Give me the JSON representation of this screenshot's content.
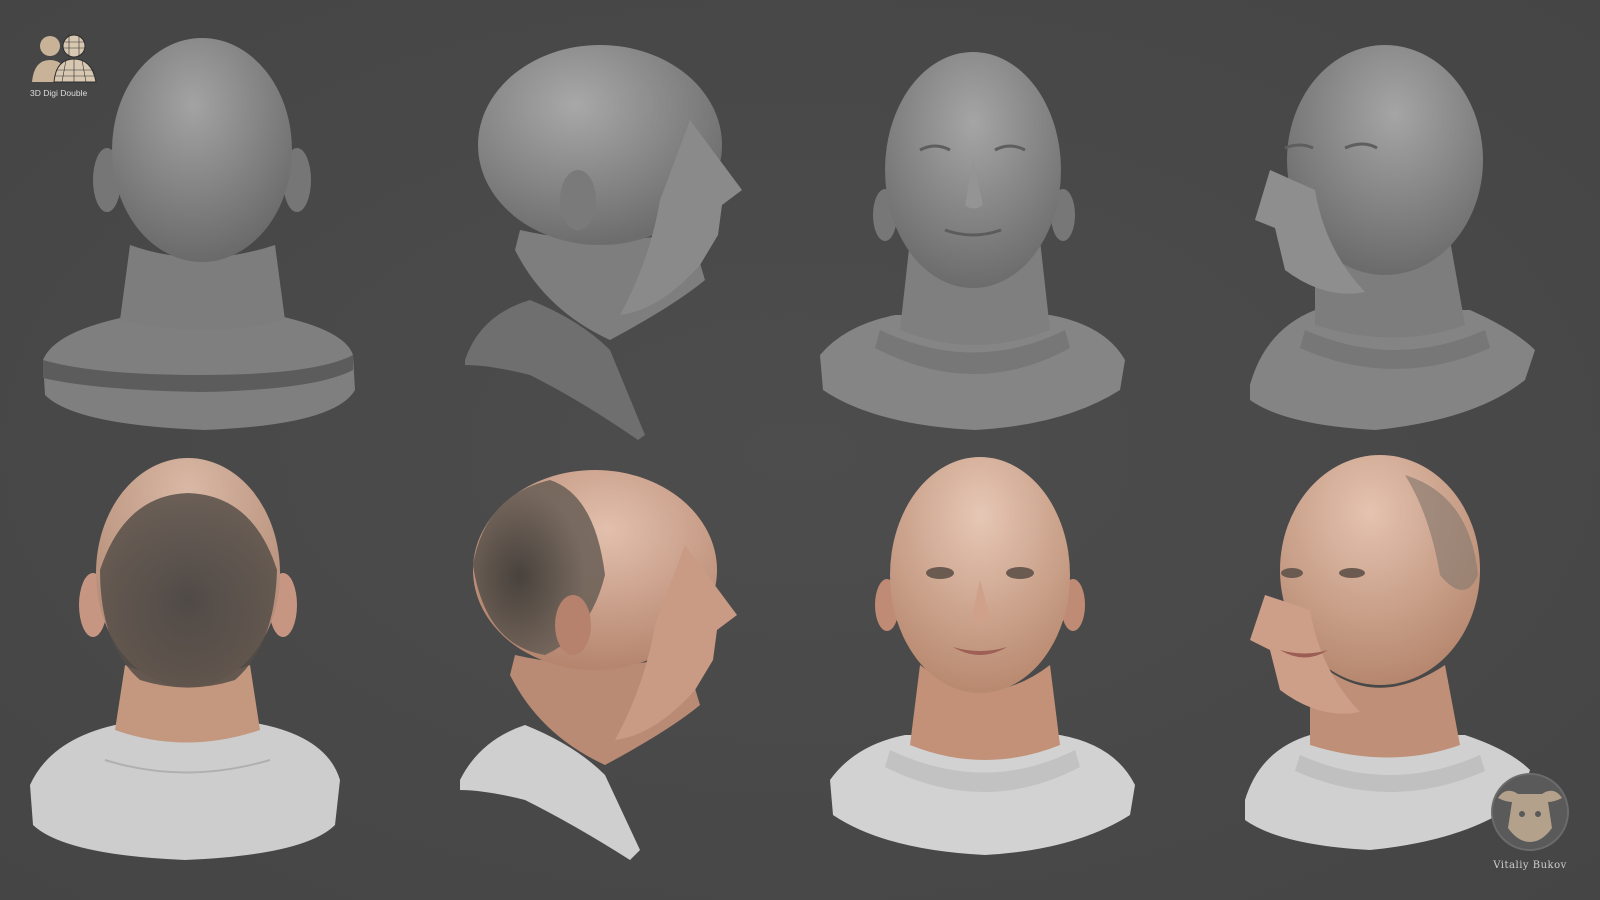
{
  "brand": {
    "logo_text": "3D Digi Double",
    "colors": {
      "background": "#4a4a4a",
      "clay": "#8a8a8a",
      "skin": "#caa08a",
      "shirt": "#cfcfcf",
      "hair": "#3a3a3a",
      "logo_tan": "#c9b398"
    }
  },
  "rows": [
    {
      "row_label": "",
      "views": [
        {
          "kind": "clay",
          "view": "back"
        },
        {
          "kind": "clay",
          "view": "side"
        },
        {
          "kind": "clay",
          "view": "front"
        },
        {
          "kind": "clay",
          "view": "three-quarter"
        }
      ]
    },
    {
      "row_label": "",
      "views": [
        {
          "kind": "textured",
          "view": "back"
        },
        {
          "kind": "textured",
          "view": "side"
        },
        {
          "kind": "textured",
          "view": "front"
        },
        {
          "kind": "textured",
          "view": "three-quarter"
        }
      ]
    }
  ],
  "watermark": {
    "text": "Vitaliy Bukov",
    "icon": "bull-logo-icon"
  }
}
